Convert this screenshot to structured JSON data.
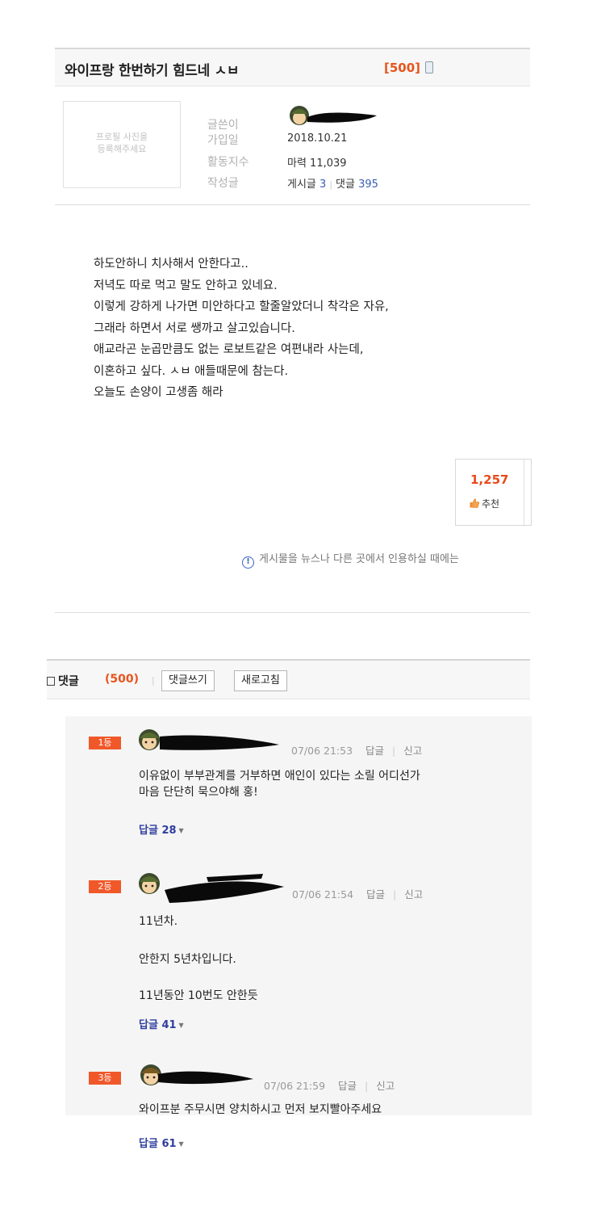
{
  "post": {
    "title": "와이프랑 한번하기 힘드네 ㅅㅂ",
    "comment_count_badge": "[500]",
    "device_icon": "mobile-icon"
  },
  "profile": {
    "photo_placeholder_line1": "프로필 사진을",
    "photo_placeholder_line2": "등록해주세요",
    "labels": {
      "author": "글쓴이",
      "join_date": "가입일",
      "activity": "활동지수",
      "posts": "작성글"
    },
    "join_date": "2018.10.21",
    "activity_value": "마력 11,039",
    "posts_label": "게시글",
    "posts_count": "3",
    "comments_label": "댓글",
    "comments_count": "395"
  },
  "body": {
    "lines": [
      "하도안하니 치사해서 안한다고..",
      "저녁도 따로 먹고 말도 안하고 있네요.",
      "이렇게 강하게 나가면 미안하다고 할줄알았더니 착각은 자유,",
      "그래라 하면서 서로 쌩까고 살고있습니다.",
      "애교라곤 눈곱만큼도 없는 로보트같은 여편내라 사는데,",
      "이혼하고 싶다. ㅅㅂ 애들때문에 참는다.",
      "오늘도 손양이 고생좀 해라"
    ]
  },
  "recommend": {
    "count": "1,257",
    "label": "추천",
    "icon": "thumbs-up-icon"
  },
  "notice": {
    "text": "게시물을 뉴스나 다른 곳에서 인용하실 때에는",
    "icon": "info-icon"
  },
  "comments_header": {
    "label": "댓글",
    "count": "(500)",
    "write_button": "댓글쓰기",
    "refresh_button": "새로고침"
  },
  "comments": [
    {
      "rank": "1등",
      "timestamp": "07/06 21:53",
      "reply_action": "답글",
      "report_action": "신고",
      "lines": [
        "이유없이 부부관계를 거부하면 애인이 있다는 소릴 어디선가",
        "마음 단단히 묵으야해 홍!"
      ],
      "replies_label": "답글",
      "replies_count": "28"
    },
    {
      "rank": "2등",
      "timestamp": "07/06 21:54",
      "reply_action": "답글",
      "report_action": "신고",
      "lines": [
        "11년차.",
        "안한지 5년차입니다.",
        "11년동안 10번도 안한듯"
      ],
      "replies_label": "답글",
      "replies_count": "41"
    },
    {
      "rank": "3등",
      "timestamp": "07/06 21:59",
      "reply_action": "답글",
      "report_action": "신고",
      "lines": [
        "와이프분 주무시면 양치하시고 먼저 보지빨아주세요"
      ],
      "replies_label": "답글",
      "replies_count": "61"
    }
  ],
  "colors": {
    "accent_orange": "#e8541d",
    "rank_badge": "#f0582a",
    "link_blue": "#3a5db5",
    "reply_blue": "#2f3e9e"
  }
}
